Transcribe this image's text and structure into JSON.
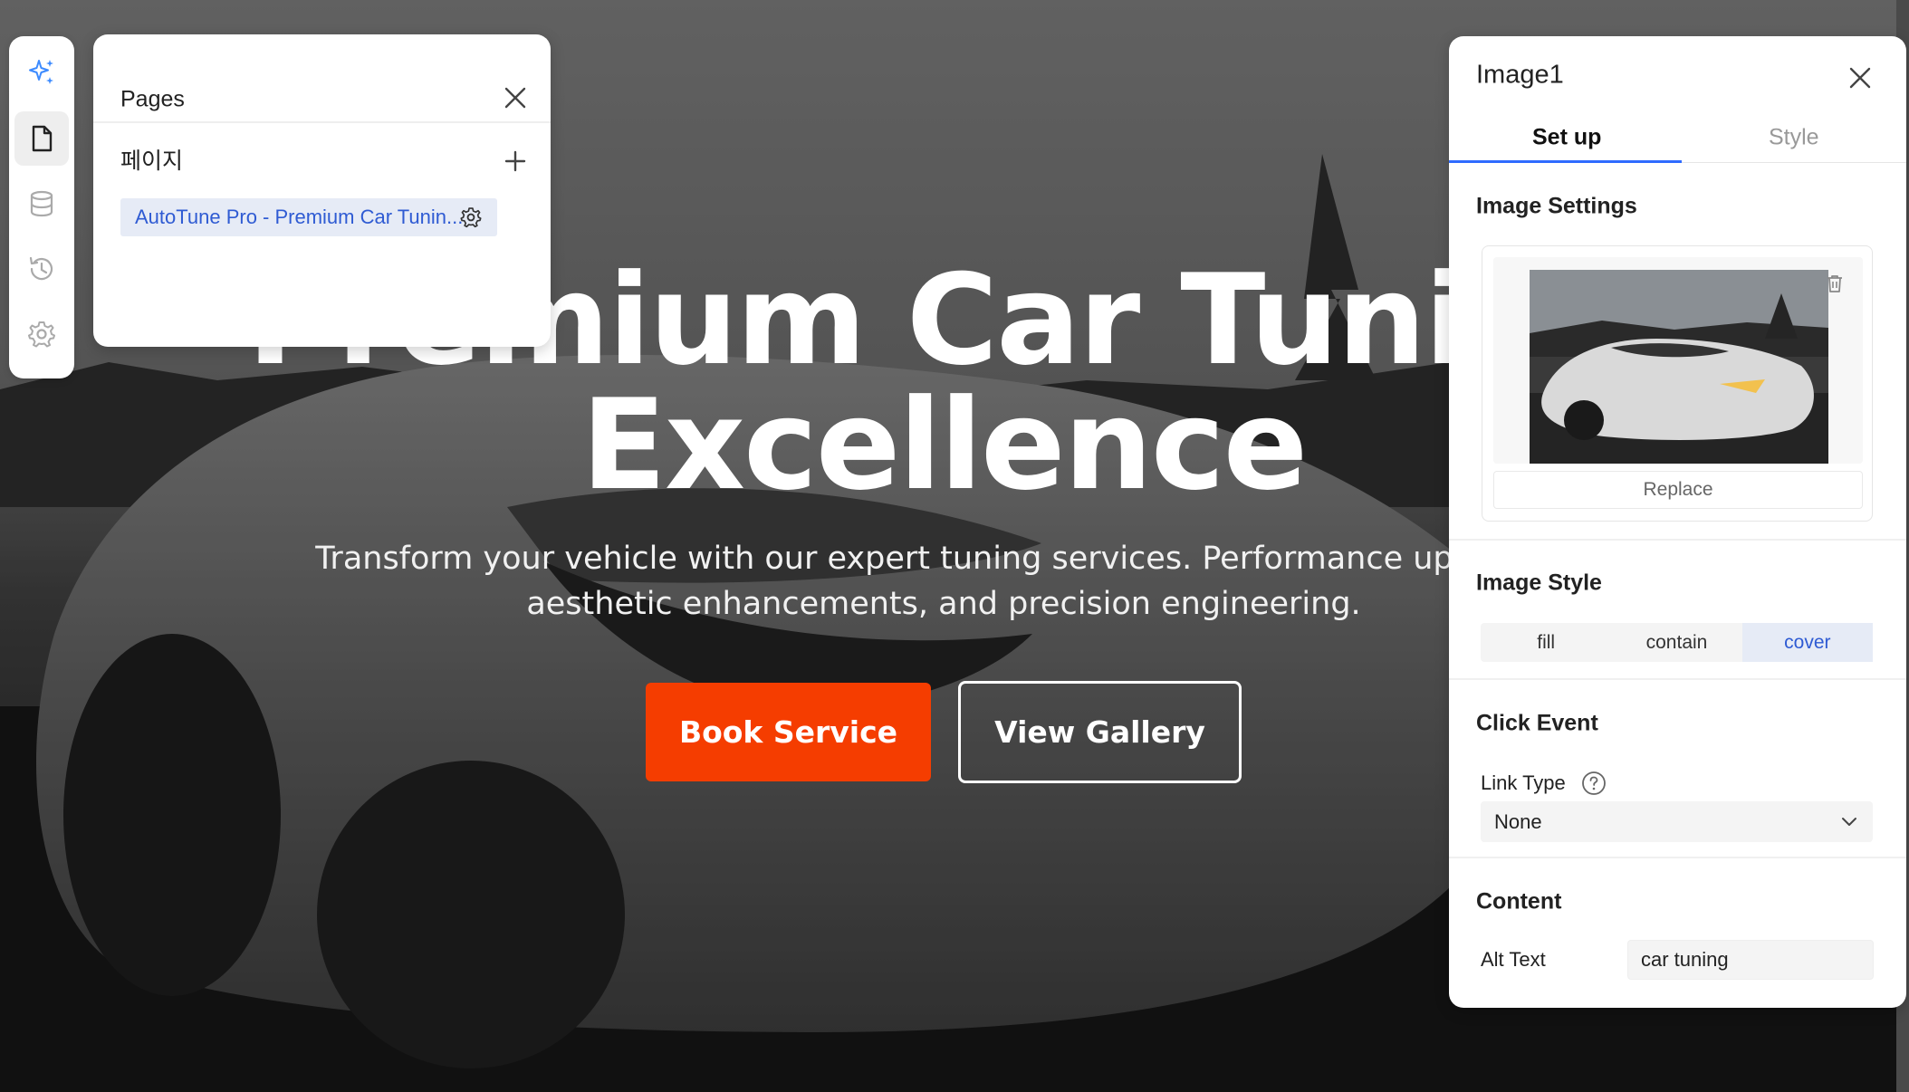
{
  "hero": {
    "title_line1": "Premium Car Tuning",
    "title_line2": "Excellence",
    "subtitle_line1": "Transform your vehicle with our expert tuning services. Performance upgrades,",
    "subtitle_line2": "aesthetic enhancements, and precision engineering.",
    "book_button": "Book Service",
    "gallery_button": "View Gallery",
    "accent_color": "#f53d00"
  },
  "rail": {
    "items": [
      "ai-sparkle-icon",
      "page-icon",
      "database-icon",
      "history-icon",
      "gear-icon"
    ],
    "active": "page-icon"
  },
  "pages_panel": {
    "title": "Pages",
    "section_label": "페이지",
    "pages": [
      {
        "label": "AutoTune Pro - Premium Car Tunin...",
        "selected": true
      }
    ]
  },
  "props_panel": {
    "title": "Image1",
    "tabs": [
      "Set up",
      "Style"
    ],
    "active_tab": "Set up",
    "image_settings": {
      "title": "Image Settings",
      "replace_label": "Replace"
    },
    "image_style": {
      "title": "Image Style",
      "options": [
        "fill",
        "contain",
        "cover"
      ],
      "selected": "cover"
    },
    "click_event": {
      "title": "Click Event",
      "link_type_label": "Link Type",
      "link_type_value": "None"
    },
    "content": {
      "title": "Content",
      "alt_text_label": "Alt Text",
      "alt_text_value": "car tuning"
    },
    "accent_color": "#2f6bff"
  }
}
